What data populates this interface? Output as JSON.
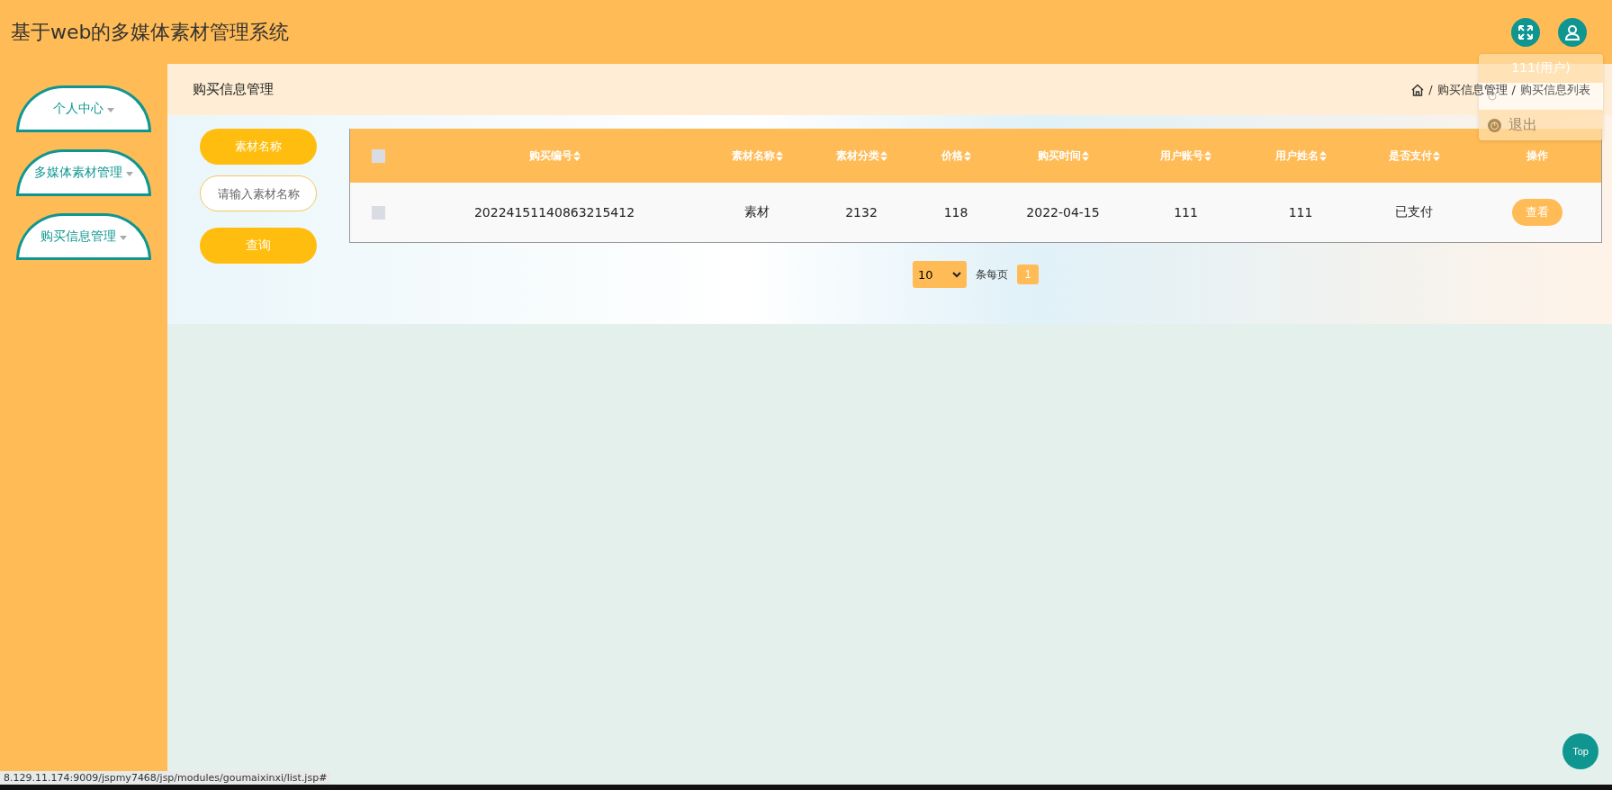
{
  "header": {
    "title": "基于web的多媒体素材管理系统"
  },
  "user_menu": {
    "title": "111(用户)",
    "items": [
      {
        "kind": "icon-only"
      },
      {
        "kind": "labeled",
        "label": "退出"
      }
    ]
  },
  "sidebar": {
    "items": [
      {
        "label": "个人中心"
      },
      {
        "label": "多媒体素材管理"
      },
      {
        "label": "购买信息管理"
      }
    ]
  },
  "page_title": "购买信息管理",
  "breadcrumb": [
    {
      "separator": "/",
      "label": "购买信息管理"
    },
    {
      "separator": "/",
      "label": "购买信息列表"
    }
  ],
  "search": {
    "label": "素材名称",
    "placeholder": "请输入素材名称",
    "button": "查询"
  },
  "table": {
    "select_all_checked": false,
    "columns": [
      {
        "label": "购买编号",
        "sortable": true
      },
      {
        "label": "素材名称",
        "sortable": true
      },
      {
        "label": "素材分类",
        "sortable": true
      },
      {
        "label": "价格",
        "sortable": true
      },
      {
        "label": "购买时间",
        "sortable": true
      },
      {
        "label": "用户账号",
        "sortable": true
      },
      {
        "label": "用户姓名",
        "sortable": true
      },
      {
        "label": "是否支付",
        "sortable": true
      },
      {
        "label": "操作",
        "sortable": false
      }
    ],
    "rows": [
      {
        "checked": false,
        "cells": [
          "20224151140863215412",
          "素材",
          "2132",
          "118",
          "2022-04-15",
          "111",
          "111",
          "已支付"
        ],
        "action": "查看"
      }
    ]
  },
  "pagination": {
    "page_size": "10",
    "per_page_label": "条每页",
    "pages": [
      {
        "label": "1",
        "selected": true
      }
    ]
  },
  "back_to_top": "Top",
  "status_bar": "8.129.11.174:9009/jspmy7468/jsp/modules/goumaixinxi/list.jsp#"
}
